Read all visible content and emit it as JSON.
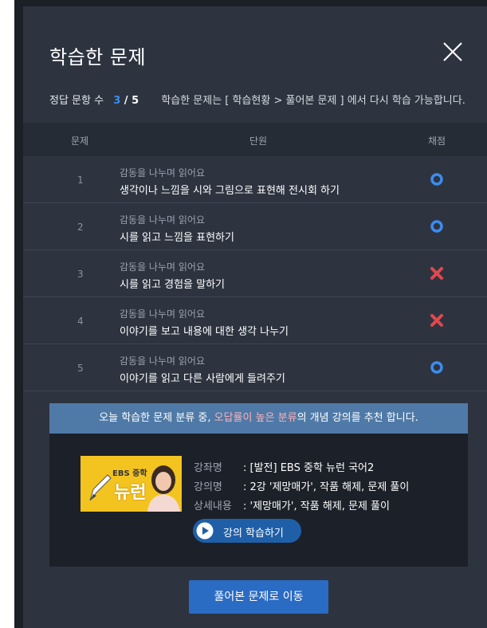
{
  "modal": {
    "title": "학습한 문제",
    "summary_label": "정답 문항 수",
    "correct": "3",
    "separator": " / ",
    "total": "5",
    "note": "학습한 문제는 [ 학습현황 > 풀어본 문제 ] 에서 다시 학습 가능합니다."
  },
  "table": {
    "headers": {
      "no": "문제",
      "unit": "단원",
      "grade": "채점"
    },
    "rows": [
      {
        "no": "1",
        "unit": "감동을 나누며 읽어요",
        "topic": "생각이나 느낌을 시와 그림으로 표현해 전시회 하기",
        "result": "correct",
        "icon": "circle-o-icon"
      },
      {
        "no": "2",
        "unit": "감동을 나누며 읽어요",
        "topic": "시를 읽고 느낌을 표현하기",
        "result": "correct",
        "icon": "circle-o-icon"
      },
      {
        "no": "3",
        "unit": "감동을 나누며 읽어요",
        "topic": "시를 읽고 경험을 말하기",
        "result": "wrong",
        "icon": "x-mark-icon"
      },
      {
        "no": "4",
        "unit": "감동을 나누며 읽어요",
        "topic": "이야기를 보고 내용에 대한 생각 나누기",
        "result": "wrong",
        "icon": "x-mark-icon"
      },
      {
        "no": "5",
        "unit": "감동을 나누며 읽어요",
        "topic": "이야기를 읽고 다른 사람에게 들려주기",
        "result": "correct",
        "icon": "circle-o-icon"
      }
    ]
  },
  "recommend": {
    "banner_pre": "오늘 학습한 문제 분류 중, ",
    "banner_highlight": "오답률이 높은 분류",
    "banner_post": "의 개념 강의를 추천 합니다.",
    "thumb_brand": "EBS 중학",
    "thumb_logo": "뉴런",
    "course_label": "강좌명",
    "course_value": ": [발전] EBS 중학 뉴런 국어2",
    "lecture_label": "강의명",
    "lecture_value": ": 2강 '제망매가', 작품 해제, 문제 풀이",
    "detail_label": "상세내용",
    "detail_value": ": '제망매가', 작품 해제, 문제 풀이",
    "play_label": "강의 학습하기"
  },
  "footer": {
    "go_label": "풀어본 문제로 이동"
  },
  "colors": {
    "correct": "#3d8cf0",
    "wrong": "#e0484f",
    "accent": "#2a6bc3"
  }
}
